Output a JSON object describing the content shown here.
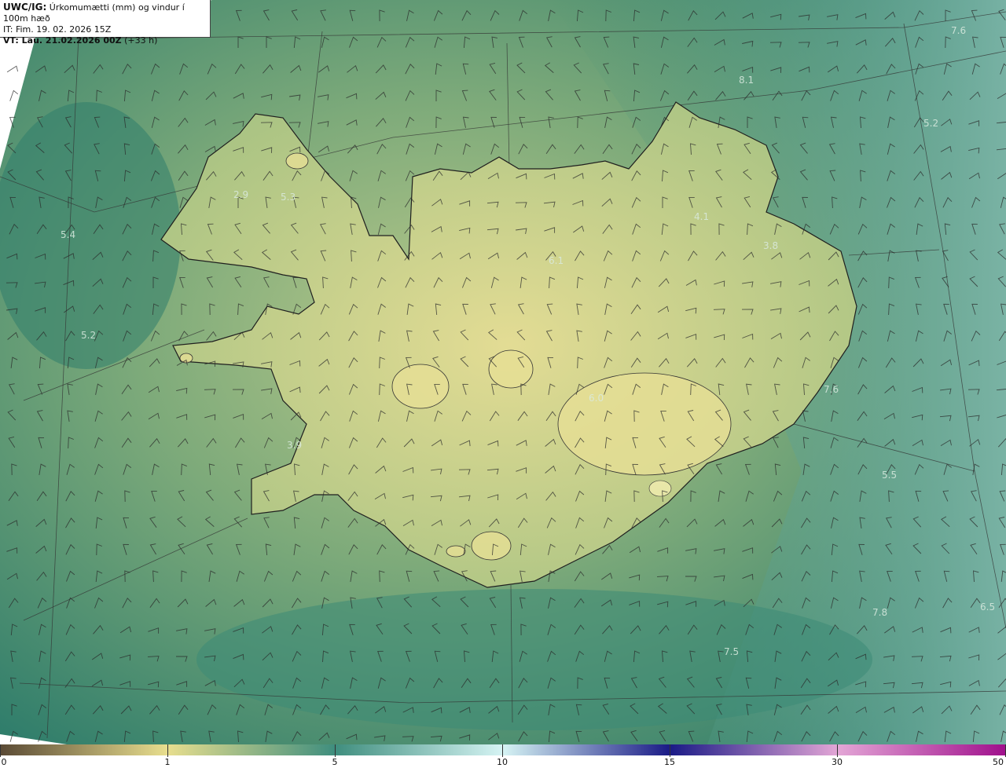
{
  "header": {
    "model": "UWC/IG:",
    "title": "Úrkomumætti (mm) og vindur í 100m hæð",
    "it_line": "IT: Fim. 19. 02. 2026 15Z",
    "vt_label": "VT: Lau. 21.02.2026 00Z",
    "vt_offset": "(+33 h)"
  },
  "map_labels": [
    "7.6",
    "8.1",
    "5.2",
    "5.4",
    "5.3",
    "2.9",
    "4.1",
    "3.8",
    "6.1",
    "5.2",
    "7.6",
    "6.0",
    "5.5",
    "3.9",
    "7.8",
    "6.5",
    "7.5"
  ],
  "colorbar": {
    "ticks": [
      "0",
      "1",
      "5",
      "10",
      "15",
      "30",
      "50"
    ],
    "stops": [
      {
        "value": "0",
        "color": "#5a4a35"
      },
      {
        "value": "1",
        "color": "#e8de8e"
      },
      {
        "value": "5",
        "color": "#3f8e7e"
      },
      {
        "value": "10",
        "color": "#d6f4f4"
      },
      {
        "value": "15",
        "color": "#1a1a86"
      },
      {
        "value": "30",
        "color": "#e3a6d6"
      },
      {
        "value": "50",
        "color": "#a0108c"
      }
    ]
  },
  "colors": {
    "ocean_dark": "#2f7d6b",
    "ocean_mid": "#4a9a80",
    "ocean_light": "#7fb7aa",
    "land_yellow": "#d9d68e",
    "land_green": "#9fbd7e",
    "coast": "#1f1f1f"
  }
}
